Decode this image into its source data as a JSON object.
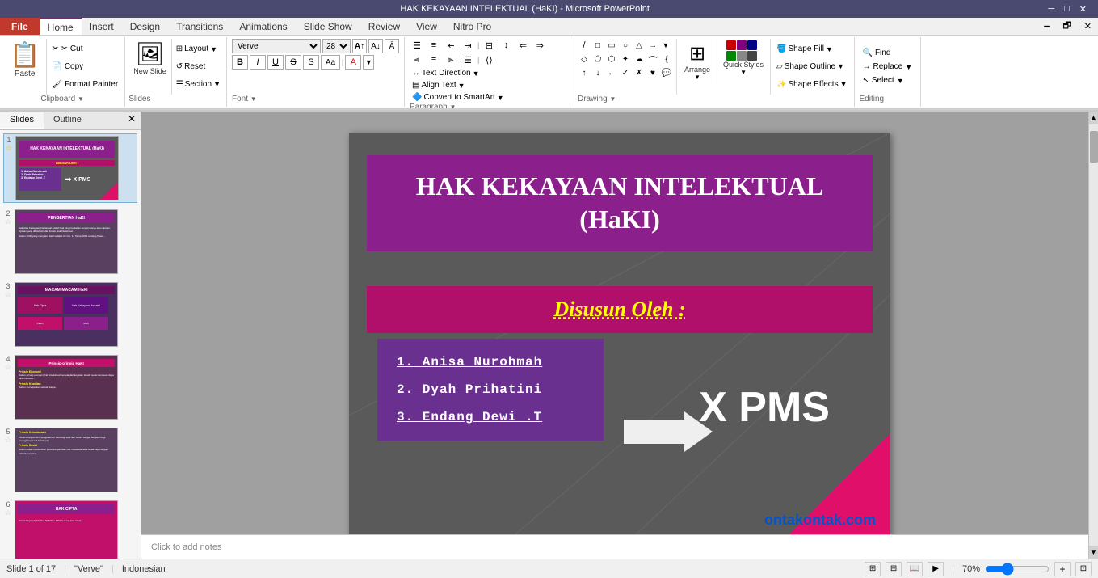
{
  "titlebar": {
    "title": "HAK KEKAYAAN INTELEKTUAL (HaKI) - Microsoft PowerPoint",
    "controls": [
      "minimize",
      "maximize",
      "close"
    ]
  },
  "ribbon": {
    "tabs": [
      "File",
      "Home",
      "Insert",
      "Design",
      "Transitions",
      "Animations",
      "Slide Show",
      "Review",
      "View",
      "Nitro Pro"
    ],
    "active_tab": "Home",
    "groups": {
      "clipboard": {
        "label": "Clipboard",
        "paste": "Paste",
        "cut": "✂ Cut",
        "copy": "📋 Copy",
        "format_painter": "Format Painter"
      },
      "slides": {
        "label": "Slides",
        "new_slide": "New Slide",
        "layout": "Layout",
        "reset": "Reset",
        "section": "Section"
      },
      "font": {
        "label": "Font",
        "font_name": "Verve",
        "font_size": "28",
        "bold": "B",
        "italic": "I",
        "underline": "U",
        "strikethrough": "S",
        "shadow": "S",
        "increase_size": "A",
        "decrease_size": "A",
        "clear_format": "A",
        "change_case": "Aa",
        "font_color": "A"
      },
      "paragraph": {
        "label": "Paragraph",
        "text_direction": "Text Direction",
        "align_text": "Align Text",
        "convert_smartart": "Convert to SmartArt"
      },
      "drawing": {
        "label": "Drawing",
        "arrange": "Arrange",
        "quick_styles": "Quick Styles",
        "shape_fill": "Shape Fill",
        "shape_outline": "Shape Outline",
        "shape_effects": "Shape Effects"
      },
      "editing": {
        "label": "Editing",
        "find": "Find",
        "replace": "Replace",
        "select": "Select"
      }
    }
  },
  "slide_panel": {
    "tabs": [
      "Slides",
      "Outline"
    ],
    "slides": [
      {
        "num": "1",
        "active": true
      },
      {
        "num": "2",
        "active": false
      },
      {
        "num": "3",
        "active": false
      },
      {
        "num": "4",
        "active": false
      },
      {
        "num": "5",
        "active": false
      },
      {
        "num": "6",
        "active": false
      }
    ]
  },
  "slide": {
    "title_line1": "HAK KEKAYAAN INTELEKTUAL",
    "title_line2": "(HaKI)",
    "subtitle": "Disusun Oleh :",
    "names": [
      "1.   Anisa Nurohmah",
      "2.   Dyah Prihatini",
      "3.   Endang Dewi .T"
    ],
    "class": "X PMS"
  },
  "notes": {
    "placeholder": "Click to add notes"
  },
  "status": {
    "slide_info": "Slide 1 of 17",
    "theme": "\"Verve\"",
    "language": "Indonesian",
    "zoom": "70%"
  },
  "watermark": {
    "text": "ontakontak.com"
  }
}
